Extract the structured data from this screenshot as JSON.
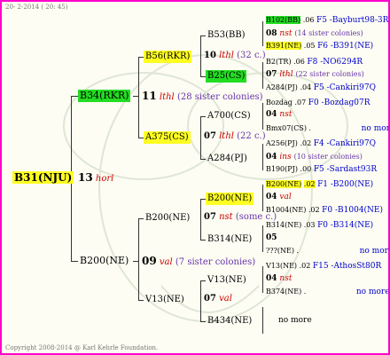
{
  "date": "20- 2-2014 ( 20: 45)",
  "copyright": "Copyright 2008-2014 @ Karl Kehrle Foundation.",
  "root": {
    "name": "B31(NJU)",
    "num": "13",
    "pop": "horl"
  },
  "gen1": [
    {
      "name": "B34(RKR)",
      "num": "11",
      "pop": "lthl",
      "note": "(28 sister colonies)"
    },
    {
      "name": "B200(NE)",
      "num": "09",
      "pop": "val",
      "note": "(7 sister colonies)"
    }
  ],
  "gen2": [
    {
      "name": "B56(RKR)",
      "num": "10",
      "pop": "lthl",
      "note": "(32 c.)"
    },
    {
      "name": "A375(CS)",
      "num": "07",
      "pop": "lthl",
      "note": "(22 c.)"
    },
    {
      "name": "B200(NE)",
      "num": "07",
      "pop": "nst",
      "note": "(some c.)"
    },
    {
      "name": "V13(NE)",
      "num": "07",
      "pop": "val",
      "note": ""
    }
  ],
  "gen3": [
    {
      "name": "B53(BB)",
      "num": "08",
      "pop": "nst",
      "note": "(14 sister colonies)"
    },
    {
      "name": "B25(CS)",
      "num": "07",
      "pop": "lthl",
      "note": "(22 sister colonies)"
    },
    {
      "name": "A700(CS)",
      "num": "04",
      "pop": "nst",
      "note": ""
    },
    {
      "name": "A284(PJ)",
      "num": "04",
      "pop": "ins",
      "note": "(10 sister colonies)"
    },
    {
      "name": "B200(NE)",
      "num": "04",
      "pop": "val",
      "note": ""
    },
    {
      "name": "B314(NE)",
      "num": "05",
      "pop": "",
      "note": ""
    },
    {
      "name": "V13(NE)",
      "num": "04",
      "pop": "nst",
      "note": ""
    },
    {
      "name": "B434(NE)",
      "num": "",
      "pop": "",
      "note": ""
    }
  ],
  "gen4": [
    {
      "name": "B102(BB)",
      "val": ".06",
      "code": "F5 -Bayburt98-3R"
    },
    {
      "name": "B391(NE)",
      "val": ".05",
      "code": "F6 -B391(NE)"
    },
    {
      "name": "B2(TR)",
      "val": ".06",
      "code": "F8 -NO6294R"
    },
    {
      "name": "A284(PJ)",
      "val": ".04",
      "code": "F5 -Cankiri97Q"
    },
    {
      "name": "Bozdag",
      "val": ".07",
      "code": "F0 -Bozdag07R"
    },
    {
      "name": "Bmx07(CS)",
      "val": ".",
      "code": "no more"
    },
    {
      "name": "A256(PJ)",
      "val": ".02",
      "code": "F4 -Cankiri97Q"
    },
    {
      "name": "B190(PJ)",
      "val": ".00",
      "code": "F5 -Sardast93R"
    },
    {
      "name": "B200(NE)",
      "val": ".02",
      "code": "F1 -B200(NE)"
    },
    {
      "name": "B1004(NE)",
      "val": ".02",
      "code": "F0 -B1004(NE)"
    },
    {
      "name": "B314(NE)",
      "val": ".03",
      "code": "F0 -B314(NE)"
    },
    {
      "name": "???(NE)",
      "val": ".",
      "code": "no more"
    },
    {
      "name": "V13(NE)",
      "val": ".02",
      "code": "F15 -AthosSt80R"
    },
    {
      "name": "B374(NE)",
      "val": ".",
      "code": "no more"
    },
    {
      "name": "",
      "val": "",
      "code": "no more"
    }
  ],
  "colors": {
    "frame": "#ff00cc",
    "green": "#22dd22",
    "yellow": "#ffff22",
    "red": "#cc0000",
    "link": "#0000cc"
  }
}
